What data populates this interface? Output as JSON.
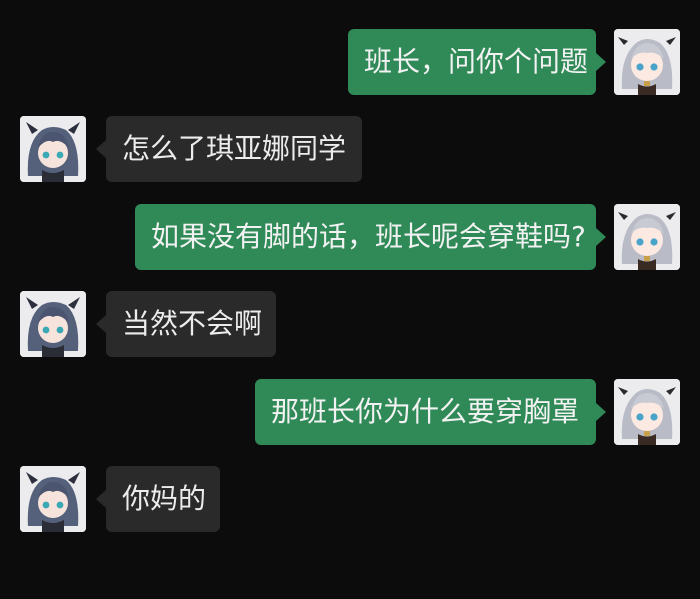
{
  "theme": {
    "background": "#0c0c0c",
    "sent_bubble_color": "#2f8a57",
    "received_bubble_color": "#2a2a2a",
    "text_color": "#f2f2f2"
  },
  "avatars": {
    "self": "silver-haired-anime-girl-avatar",
    "other": "blue-haired-anime-girl-avatar"
  },
  "messages": [
    {
      "side": "right",
      "text": "班长，问你个问题"
    },
    {
      "side": "left",
      "text": "怎么了琪亚娜同学"
    },
    {
      "side": "right",
      "text": "如果没有脚的话，班长呢会穿鞋吗?"
    },
    {
      "side": "left",
      "text": "当然不会啊"
    },
    {
      "side": "right",
      "text": "那班长你为什么要穿胸罩"
    },
    {
      "side": "left",
      "text": "你妈的"
    }
  ]
}
